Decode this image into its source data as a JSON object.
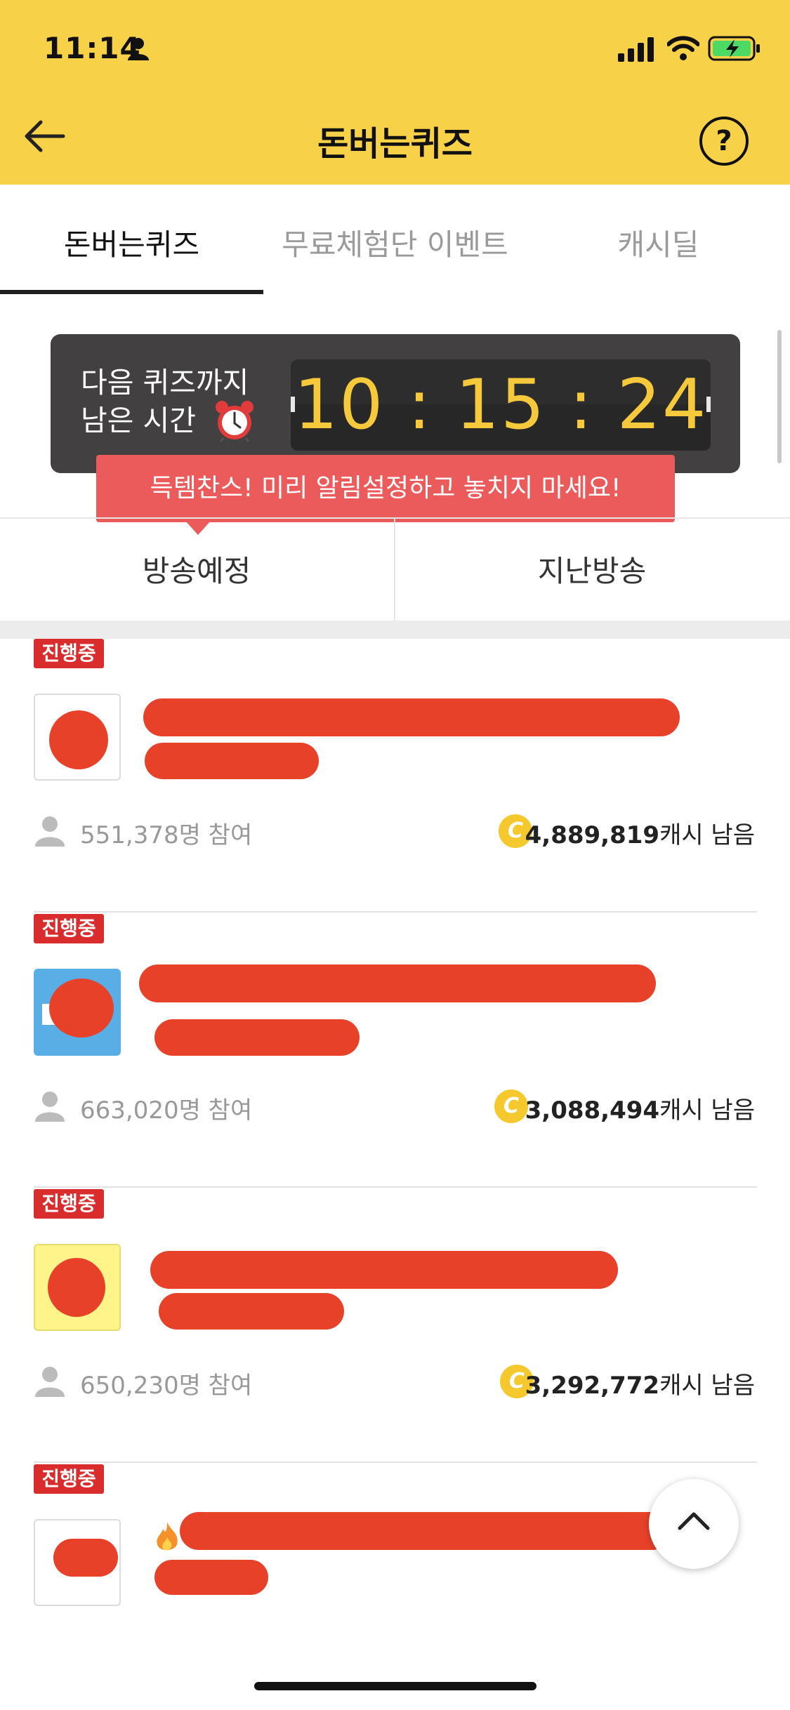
{
  "status": {
    "time": "11:14"
  },
  "header": {
    "title": "돈버는퀴즈",
    "help_label": "?"
  },
  "tabs": [
    {
      "label": "돈버는퀴즈",
      "active": true
    },
    {
      "label": "무료체험단 이벤트",
      "active": false
    },
    {
      "label": "캐시딜",
      "active": false
    }
  ],
  "timer": {
    "label_line1": "다음 퀴즈까지",
    "label_line2": "남은 시간",
    "value": "10 : 15 : 24",
    "tooltip": "득템찬스! 미리 알림설정하고 놓치지 마세요!"
  },
  "subtabs": [
    {
      "label": "방송예정"
    },
    {
      "label": "지난방송"
    }
  ],
  "quizzes": [
    {
      "badge": "진행중",
      "participants": "551,378명 참여",
      "coin": "C",
      "remaining_amount": "4,889,819",
      "remaining_unit": "캐시 남음"
    },
    {
      "badge": "진행중",
      "participants": "663,020명 참여",
      "coin": "C",
      "remaining_amount": "3,088,494",
      "remaining_unit": "캐시 남음"
    },
    {
      "badge": "진행중",
      "participants": "650,230명 참여",
      "coin": "C",
      "remaining_amount": "3,292,772",
      "remaining_unit": "캐시 남음"
    },
    {
      "badge": "진행중"
    }
  ],
  "colors": {
    "header_bg": "#f7d147",
    "badge": "#d92d2d",
    "timer_digits": "#f6c93c",
    "tooltip": "#ec5b5b"
  }
}
